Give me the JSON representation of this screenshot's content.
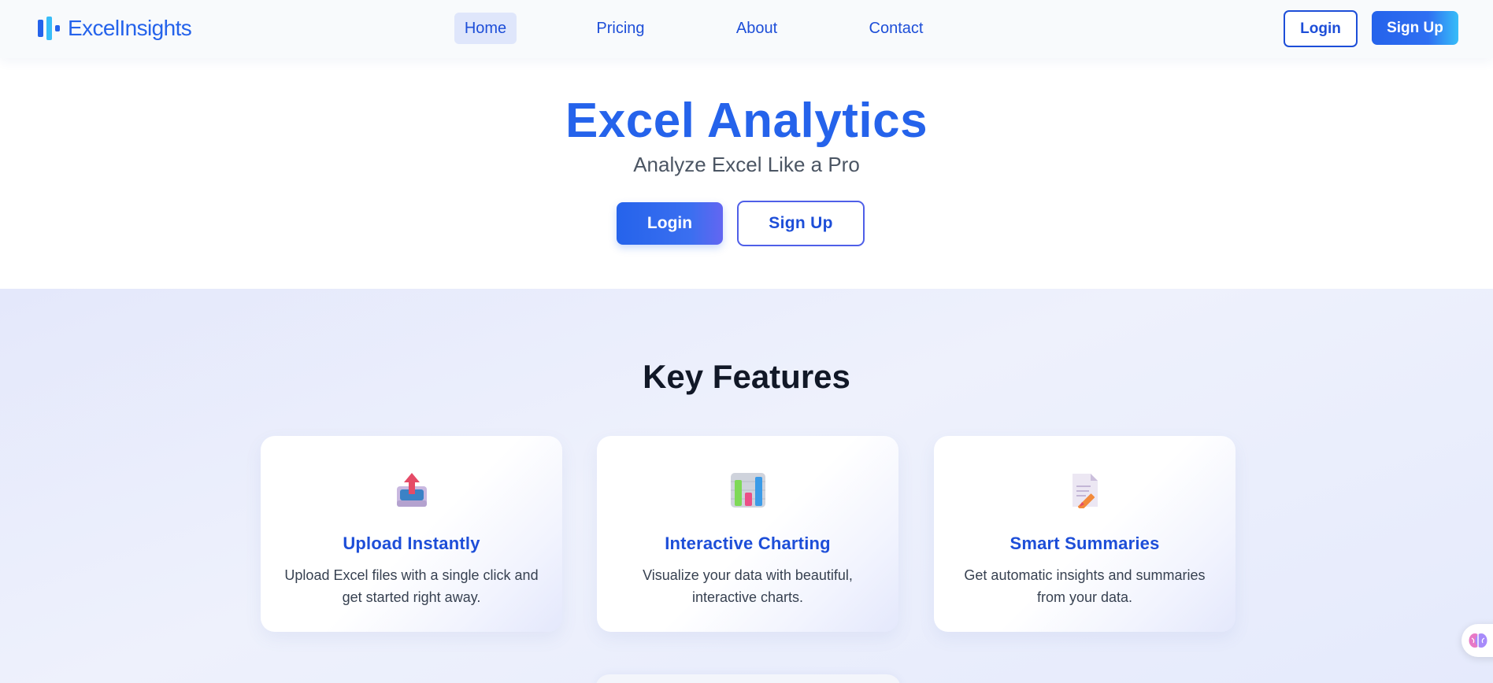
{
  "navbar": {
    "brand": "ExcelInsights",
    "links": [
      {
        "label": "Home",
        "active": true
      },
      {
        "label": "Pricing",
        "active": false
      },
      {
        "label": "About",
        "active": false
      },
      {
        "label": "Contact",
        "active": false
      }
    ],
    "login_label": "Login",
    "signup_label": "Sign Up"
  },
  "hero": {
    "title": "Excel Analytics",
    "subtitle": "Analyze Excel Like a Pro",
    "login_label": "Login",
    "signup_label": "Sign Up"
  },
  "features": {
    "heading": "Key Features",
    "cards": [
      {
        "icon": "upload-tray-icon",
        "title": "Upload Instantly",
        "description": "Upload Excel files with a single click and get started right away."
      },
      {
        "icon": "bar-chart-icon",
        "title": "Interactive Charting",
        "description": "Visualize your data with beautiful, interactive charts."
      },
      {
        "icon": "memo-icon",
        "title": "Smart Summaries",
        "description": "Get automatic insights and summaries from your data."
      }
    ]
  },
  "colors": {
    "brand": "#2563eb",
    "brand_dark": "#1d4ed8",
    "accent": "#38bdf8",
    "section_bg": "#e8ecfc",
    "heading_text": "#111827"
  },
  "widget": {
    "icon": "brain-icon"
  }
}
